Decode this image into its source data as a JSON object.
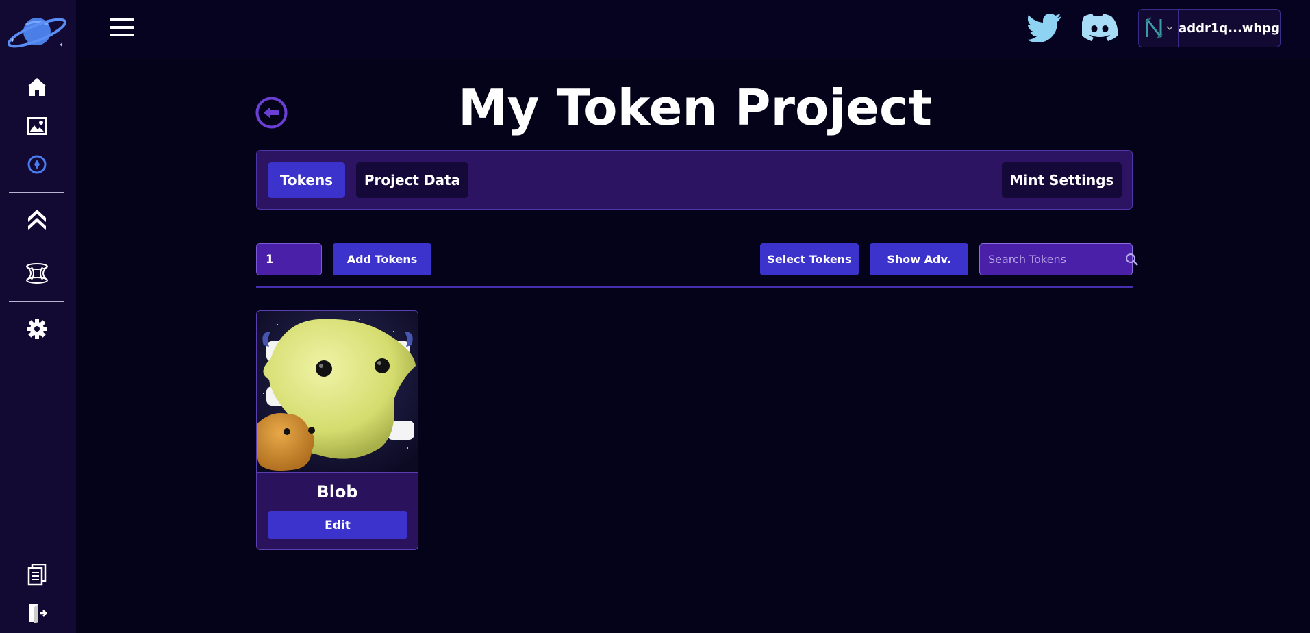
{
  "topbar": {
    "wallet_address": "addr1q...whpg"
  },
  "page": {
    "title": "My Token Project"
  },
  "tabs": [
    {
      "label": "Tokens",
      "active": true
    },
    {
      "label": "Project Data",
      "active": false
    },
    {
      "label": "Mint Settings",
      "active": false
    }
  ],
  "toolbar": {
    "quantity_value": "1",
    "add_tokens_label": "Add Tokens",
    "select_tokens_label": "Select Tokens",
    "show_adv_label": "Show Adv.",
    "search_placeholder": "Search Tokens"
  },
  "tokens": [
    {
      "name": "Blob",
      "edit_label": "Edit"
    }
  ],
  "colors": {
    "background": "#05031a",
    "sidebar": "#120a33",
    "accent": "#3b33cc",
    "panel": "#2d1463",
    "twitter": "#8fd3f2",
    "discord": "#a8dcf6",
    "active_icon": "#4a7bf0"
  },
  "icons": {
    "sidebar": [
      "home-icon",
      "image-icon",
      "compass-icon",
      "chevrons-up-icon",
      "wormhole-icon",
      "gear-icon",
      "documents-icon",
      "logout-icon"
    ],
    "header": [
      "menu-icon",
      "twitter-icon",
      "discord-icon",
      "nami-wallet-icon"
    ]
  }
}
